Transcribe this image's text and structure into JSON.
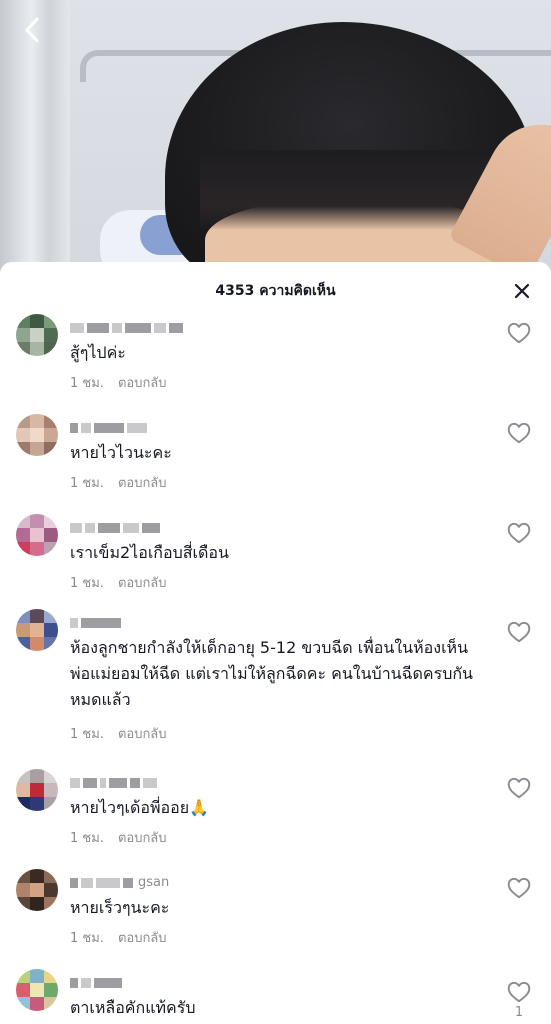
{
  "header": {
    "title": "4353 ความคิดเห็น"
  },
  "reply_label": "ตอบกลับ",
  "comments": [
    {
      "username": "",
      "text": "สู้ๆไปค่ะ",
      "time": "1 ชม.",
      "likes": ""
    },
    {
      "username": "",
      "text": "หายไวไวนะคะ",
      "time": "1 ชม.",
      "likes": ""
    },
    {
      "username": "",
      "text": "เราเข็ม2ไอเกือบสี่เดือน",
      "time": "1 ชม.",
      "likes": ""
    },
    {
      "username": "",
      "text": "ห้องลูกชายกำลังให้เด็กอายุ 5-12 ขวบฉีด เพื่อนในห้องเห็นพ่อแม่ยอมให้ฉีด แต่เราไม่ให้ลูกฉีดคะ คนในบ้านฉีดครบกันหมดแล้ว",
      "time": "1 ชม.",
      "likes": ""
    },
    {
      "username": "",
      "text": "หายไวๆเด้อพี่ออย🙏",
      "time": "1 ชม.",
      "likes": ""
    },
    {
      "username": "gsan",
      "text": "หายเร็วๆนะคะ",
      "time": "1 ชม.",
      "likes": ""
    },
    {
      "username": "",
      "text": "ตาเหลือคักแท้ครับ",
      "time": "",
      "likes": "1"
    }
  ],
  "colors": {
    "text": "#161823",
    "muted": "#8a8b91",
    "sheet_bg": "#ffffff"
  },
  "icons": {
    "back": "chevron-left-icon",
    "close": "close-icon",
    "like": "heart-outline-icon"
  }
}
